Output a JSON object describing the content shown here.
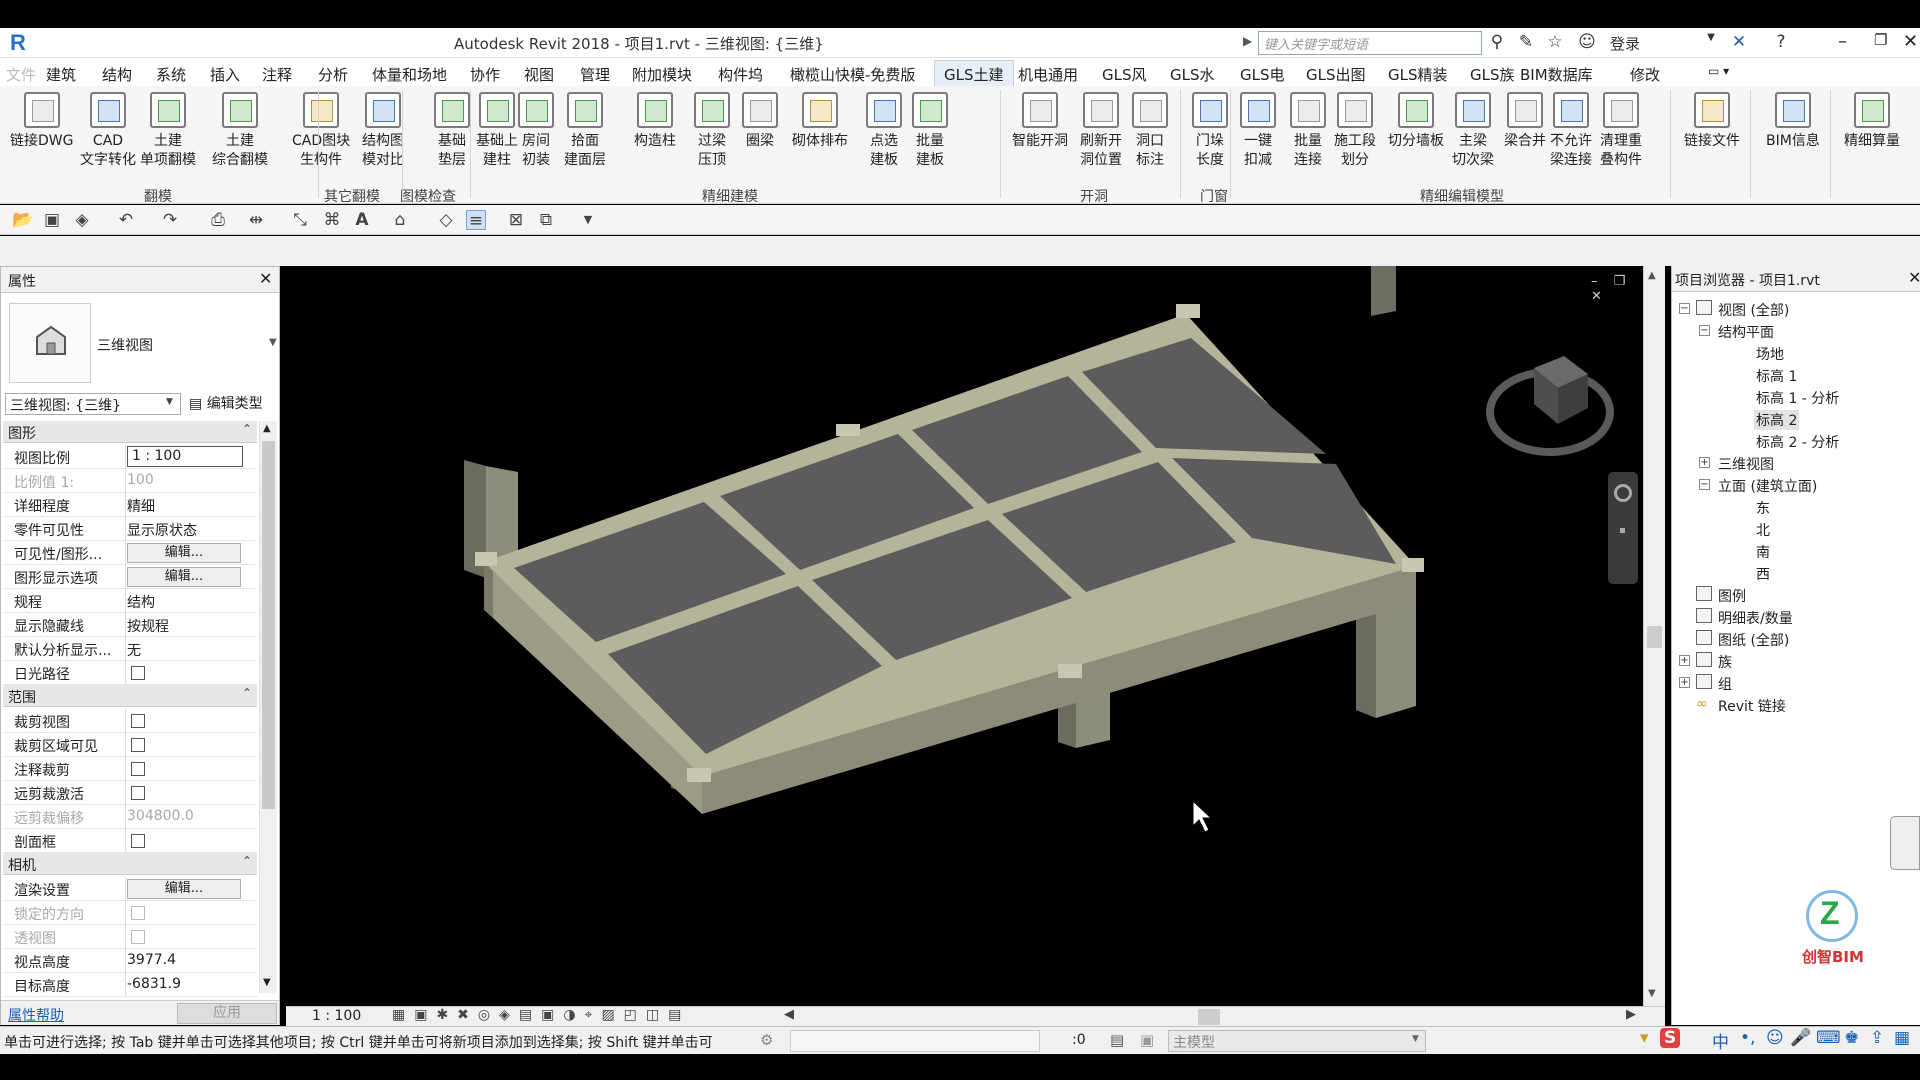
{
  "title": {
    "window_title": "Autodesk Revit 2018 -    项目1.rvt - 三维视图: {三维}",
    "search_placeholder": "键入关键字或短语",
    "login": "登录"
  },
  "menu": {
    "file": "文件",
    "tabs": [
      "建筑",
      "结构",
      "系统",
      "插入",
      "注释",
      "分析",
      "体量和场地",
      "协作",
      "视图",
      "管理",
      "附加模块",
      "构件坞",
      "橄榄山快模-免费版",
      "GLS土建",
      "机电通用",
      "GLS风",
      "GLS水",
      "GLS电",
      "GLS出图",
      "GLS精装",
      "GLS族",
      "BIM数据库",
      "修改"
    ],
    "active_tab": "GLS土建"
  },
  "ribbon": {
    "buttons": [
      {
        "l1": "链接DWG",
        "l2": ""
      },
      {
        "l1": "CAD",
        "l2": "文字转化"
      },
      {
        "l1": "土建",
        "l2": "单项翻模"
      },
      {
        "l1": "土建",
        "l2": "综合翻模"
      },
      {
        "l1": "CAD图块",
        "l2": "生构件"
      },
      {
        "l1": "结构图",
        "l2": "模对比"
      },
      {
        "l1": "基础",
        "l2": "垫层"
      },
      {
        "l1": "基础上",
        "l2": "建柱"
      },
      {
        "l1": "房间",
        "l2": "初装"
      },
      {
        "l1": "拾面",
        "l2": "建面层"
      },
      {
        "l1": "构造柱",
        "l2": ""
      },
      {
        "l1": "过梁",
        "l2": "压顶"
      },
      {
        "l1": "圈梁",
        "l2": ""
      },
      {
        "l1": "砌体排布",
        "l2": ""
      },
      {
        "l1": "点选",
        "l2": "建板"
      },
      {
        "l1": "批量",
        "l2": "建板"
      },
      {
        "l1": "智能开洞",
        "l2": ""
      },
      {
        "l1": "刷新开",
        "l2": "洞位置"
      },
      {
        "l1": "洞口",
        "l2": "标注"
      },
      {
        "l1": "门垛",
        "l2": "长度"
      },
      {
        "l1": "一键",
        "l2": "扣减"
      },
      {
        "l1": "批量",
        "l2": "连接"
      },
      {
        "l1": "施工段",
        "l2": "划分"
      },
      {
        "l1": "切分墙板",
        "l2": ""
      },
      {
        "l1": "主梁",
        "l2": "切次梁"
      },
      {
        "l1": "梁合并",
        "l2": ""
      },
      {
        "l1": "不允许",
        "l2": "梁连接"
      },
      {
        "l1": "清理重",
        "l2": "叠构件"
      },
      {
        "l1": "链接文件",
        "l2": ""
      },
      {
        "l1": "BIM信息",
        "l2": ""
      },
      {
        "l1": "精细算量",
        "l2": ""
      }
    ],
    "groups": [
      "翻模",
      "其它翻模",
      "图模检查",
      "精细建模",
      "开洞",
      "门窗",
      "精细编辑模型"
    ]
  },
  "properties": {
    "title": "属性",
    "type_name": "三维视图",
    "view_selector": "三维视图: {三维}",
    "edit_type": "编辑类型",
    "sections": {
      "graphics": "图形",
      "extents": "范围",
      "camera": "相机"
    },
    "graphics_rows": [
      {
        "label": "视图比例",
        "value": "1 : 100"
      },
      {
        "label": "比例值 1:",
        "value": "100"
      },
      {
        "label": "详细程度",
        "value": "精细"
      },
      {
        "label": "零件可见性",
        "value": "显示原状态"
      },
      {
        "label": "可见性/图形...",
        "value": "编辑..."
      },
      {
        "label": "图形显示选项",
        "value": "编辑..."
      },
      {
        "label": "规程",
        "value": "结构"
      },
      {
        "label": "显示隐藏线",
        "value": "按规程"
      },
      {
        "label": "默认分析显示...",
        "value": "无"
      },
      {
        "label": "日光路径",
        "value": ""
      }
    ],
    "extents_rows": [
      {
        "label": "裁剪视图",
        "value": ""
      },
      {
        "label": "裁剪区域可见",
        "value": ""
      },
      {
        "label": "注释裁剪",
        "value": ""
      },
      {
        "label": "远剪裁激活",
        "value": ""
      },
      {
        "label": "远剪裁偏移",
        "value": "304800.0"
      },
      {
        "label": "剖面框",
        "value": ""
      }
    ],
    "camera_rows": [
      {
        "label": "渲染设置",
        "value": "编辑..."
      },
      {
        "label": "锁定的方向",
        "value": ""
      },
      {
        "label": "透视图",
        "value": ""
      },
      {
        "label": "视点高度",
        "value": "3977.4"
      },
      {
        "label": "目标高度",
        "value": "-6831.9"
      }
    ],
    "help": "属性帮助",
    "apply": "应用"
  },
  "viewbar": {
    "scale": "1 : 100"
  },
  "browser": {
    "title": "项目浏览器 - 项目1.rvt",
    "items": {
      "views": "视图 (全部)",
      "structural_plans": "结构平面",
      "site": "场地",
      "level1": "标高 1",
      "level1_analysis": "标高 1 - 分析",
      "level2": "标高 2",
      "level2_analysis": "标高 2 - 分析",
      "views3d": "三维视图",
      "elevations": "立面 (建筑立面)",
      "east": "东",
      "north": "北",
      "south": "南",
      "west": "西",
      "legends": "图例",
      "schedules": "明细表/数量",
      "sheets": "图纸 (全部)",
      "families": "族",
      "groups": "组",
      "links": "Revit 链接"
    }
  },
  "status": {
    "hint": "单击可进行选择; 按 Tab 键并单击可选择其他项目; 按 Ctrl 键并单击可将新项目添加到选择集; 按 Shift 键并单击可",
    "count": ":0",
    "model": "主模型"
  },
  "watermark": {
    "brand": "创智BIM"
  },
  "colors": {
    "slab": "#5c5c5c",
    "beam": "#b4b49a",
    "column": "#8a8a78",
    "background": "#000000",
    "accent": "#1a5fb4"
  }
}
